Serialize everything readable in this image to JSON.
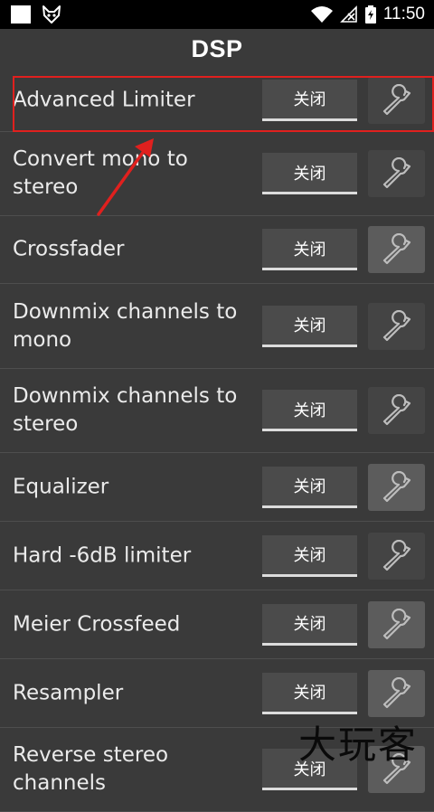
{
  "status_bar": {
    "time": "11:50"
  },
  "header": {
    "title": "DSP"
  },
  "dsp_items": [
    {
      "label": "Advanced Limiter",
      "state": "关闭"
    },
    {
      "label": "Convert mono to stereo",
      "state": "关闭"
    },
    {
      "label": "Crossfader",
      "state": "关闭"
    },
    {
      "label": "Downmix channels to mono",
      "state": "关闭"
    },
    {
      "label": "Downmix channels to stereo",
      "state": "关闭"
    },
    {
      "label": "Equalizer",
      "state": "关闭"
    },
    {
      "label": "Hard -6dB limiter",
      "state": "关闭"
    },
    {
      "label": "Meier Crossfeed",
      "state": "关闭"
    },
    {
      "label": "Resampler",
      "state": "关闭"
    },
    {
      "label": "Reverse stereo channels",
      "state": "关闭"
    }
  ],
  "watermark": "大玩客",
  "colors": {
    "background": "#3a3a3a",
    "highlight_box": "#e0201e",
    "annotation_arrow": "#e0201e"
  }
}
